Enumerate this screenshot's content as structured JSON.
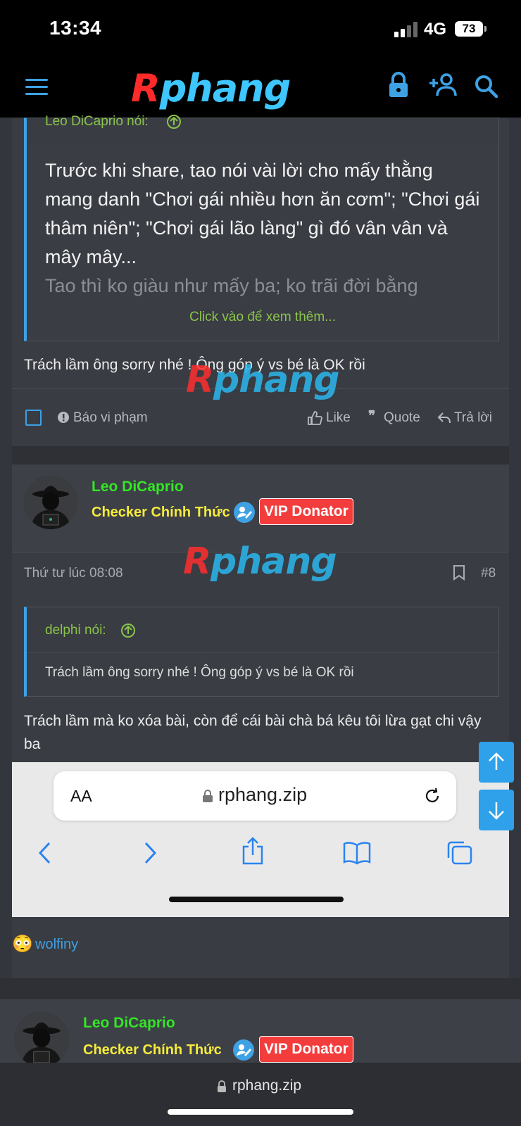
{
  "status": {
    "time": "13:34",
    "network": "4G",
    "battery": "73"
  },
  "nav": {
    "logo_r": "R",
    "logo_rest": "phang",
    "menu_icon": "hamburger-icon",
    "lock_icon": "lock-icon",
    "register_icon": "add-user-icon",
    "search_icon": "search-icon"
  },
  "post1": {
    "quote_author": "Leo DiCaprio nói:",
    "quote_text": "Trước khi share, tao nói vài lời cho mấy thằng mang danh \"Chơi gái nhiều hơn ăn cơm\"; \"Chơi gái thâm niên\"; \"Chơi gái lão làng\" gì đó vân vân và mây mây...",
    "quote_fade": "Tao thì ko giàu như mấy ba; ko trãi đời bằng",
    "expand": "Click vào để xem thêm...",
    "message": "Trách lầm ông sorry nhé ! Ông góp ý vs bé là OK rồi",
    "report": "Báo vi phạm",
    "like": "Like",
    "quote": "Quote",
    "reply": "Trả lời"
  },
  "post2": {
    "username": "Leo DiCaprio",
    "title": "Checker Chính Thức",
    "badge": "VIP Donator",
    "time": "Thứ tư lúc 08:08",
    "number": "#8",
    "quote_author": "delphi nói:",
    "quote_text": "Trách lầm ông sorry nhé ! Ông góp ý vs bé là OK rồi",
    "message": "Trách lầm mà ko xóa bài, còn để cái bài chà bá kêu tôi lừa gạt chi vậy ba",
    "reaction_user": "wolfiny",
    "reaction_emoji": "😳"
  },
  "embedded_safari": {
    "text_size": "AA",
    "url": "rphang.zip"
  },
  "post3": {
    "username": "Leo DiCaprio",
    "title": "Checker Chính Thức",
    "badge": "VIP Donator"
  },
  "watermark": {
    "r": "R",
    "rest": "phang"
  },
  "browser": {
    "url": "rphang.zip"
  }
}
